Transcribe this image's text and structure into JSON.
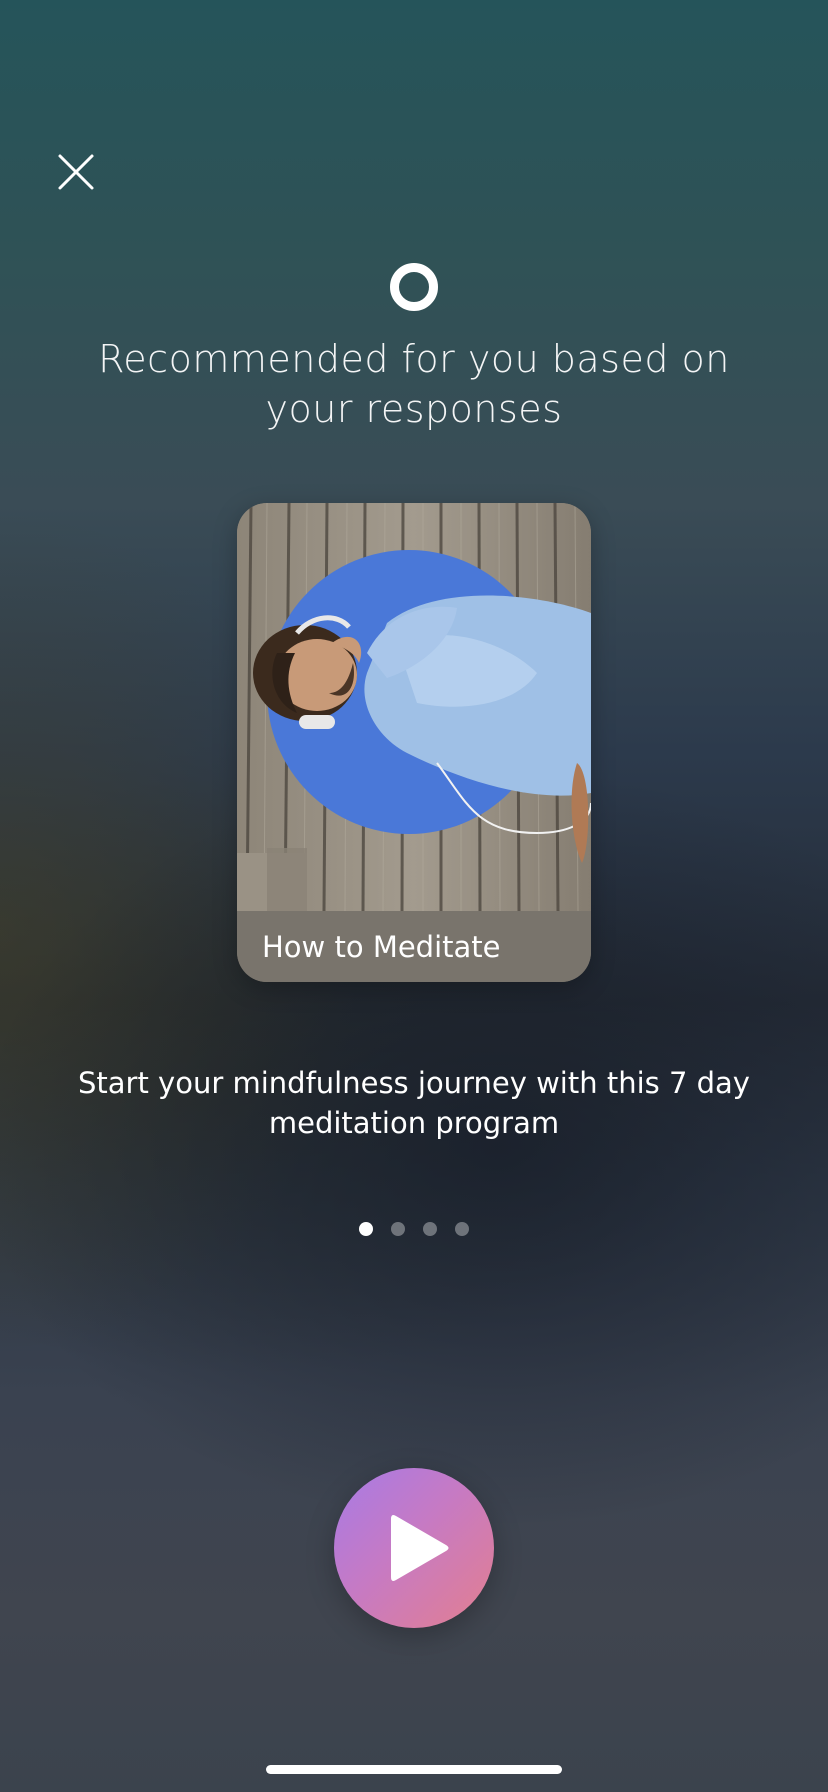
{
  "header": {
    "close_icon": "close-icon",
    "logo_icon": "ring-logo-icon"
  },
  "recommendation": {
    "headline": "Recommended for you based on your responses",
    "card": {
      "title": "How to Meditate",
      "image": "man-lying-on-dock-with-headphones"
    },
    "description": "Start your mindfulness journey with this 7 day meditation program"
  },
  "pager": {
    "total": 4,
    "active_index": 0
  },
  "play_button": {
    "icon": "play-icon",
    "gradient": [
      "#a77be6",
      "#e37f8f"
    ]
  },
  "colors": {
    "card_circle": "#4a78d8",
    "text": "#ffffff"
  }
}
